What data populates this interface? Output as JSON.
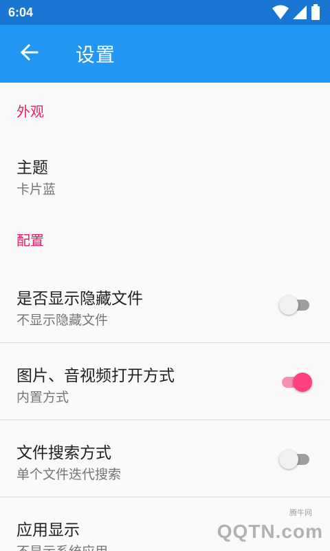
{
  "status_bar": {
    "time": "6:04",
    "icons": [
      "wifi-icon",
      "cell-signal-icon",
      "battery-icon"
    ]
  },
  "app_bar": {
    "title": "设置",
    "back_icon": "arrow-back-icon",
    "color": "#2196f3"
  },
  "sections": [
    {
      "header": "外观",
      "items": [
        {
          "title": "主题",
          "summary": "卡片蓝"
        }
      ]
    },
    {
      "header": "配置",
      "items": [
        {
          "title": "是否显示隐藏文件",
          "summary": "不显示隐藏文件",
          "switch_on": false
        },
        {
          "title": "图片、音视频打开方式",
          "summary": "内置方式",
          "switch_on": true
        },
        {
          "title": "文件搜索方式",
          "summary": "单个文件迭代搜索",
          "switch_on": false
        },
        {
          "title": "应用显示",
          "summary": "不显示系统应用"
        }
      ]
    }
  ],
  "colors": {
    "primary_dark": "#1976d2",
    "primary": "#2196f3",
    "accent": "#ff4081",
    "section_header": "#e91e63"
  },
  "watermark": {
    "small_text": "腾牛网",
    "text": "QQTN.com"
  }
}
